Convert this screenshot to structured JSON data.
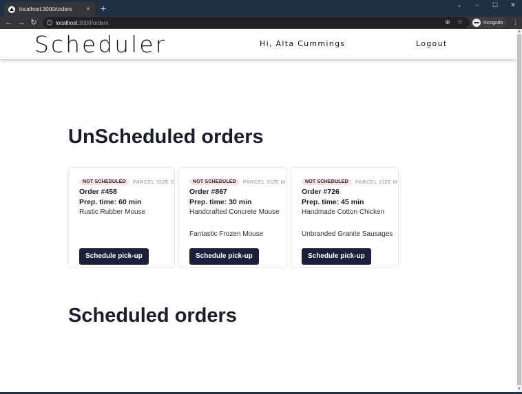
{
  "browser": {
    "tab_title": "localhost:3000/orders",
    "tab_close": "×",
    "new_tab": "+",
    "url_host": "localhost",
    "url_path": ":3000/orders",
    "incognito_label": "Incognito",
    "controls": {
      "chevron": "⌄",
      "minimize": "–",
      "maximize": "☐",
      "close": "✕"
    },
    "nav": {
      "back": "←",
      "forward": "→",
      "reload": "↻"
    }
  },
  "header": {
    "logo": "Scheduler",
    "greeting": "Hi, Alta Cummings",
    "logout": "Logout"
  },
  "unscheduled": {
    "title": "UnScheduled orders",
    "orders": [
      {
        "status": "NOT SCHEDULED",
        "parcel": "PARCEL SIZE S",
        "order": "Order #458",
        "prep": "Prep. time: 60 min",
        "products": [
          "Rustic Rubber Mouse"
        ],
        "button": "Schedule pick-up"
      },
      {
        "status": "NOT SCHEDULED",
        "parcel": "PARCEL SIZE M",
        "order": "Order #867",
        "prep": "Prep. time: 30 min",
        "products": [
          "Handcrafted Concrete Mouse",
          "Fantastic Frozen Mouse"
        ],
        "button": "Schedule pick-up"
      },
      {
        "status": "NOT SCHEDULED",
        "parcel": "PARCEL SIZE M",
        "order": "Order #726",
        "prep": "Prep. time: 45 min",
        "products": [
          "Handmade Cotton Chicken",
          "Unbranded Granite Sausages"
        ],
        "button": "Schedule pick-up"
      }
    ]
  },
  "scheduled": {
    "title": "Scheduled orders"
  }
}
